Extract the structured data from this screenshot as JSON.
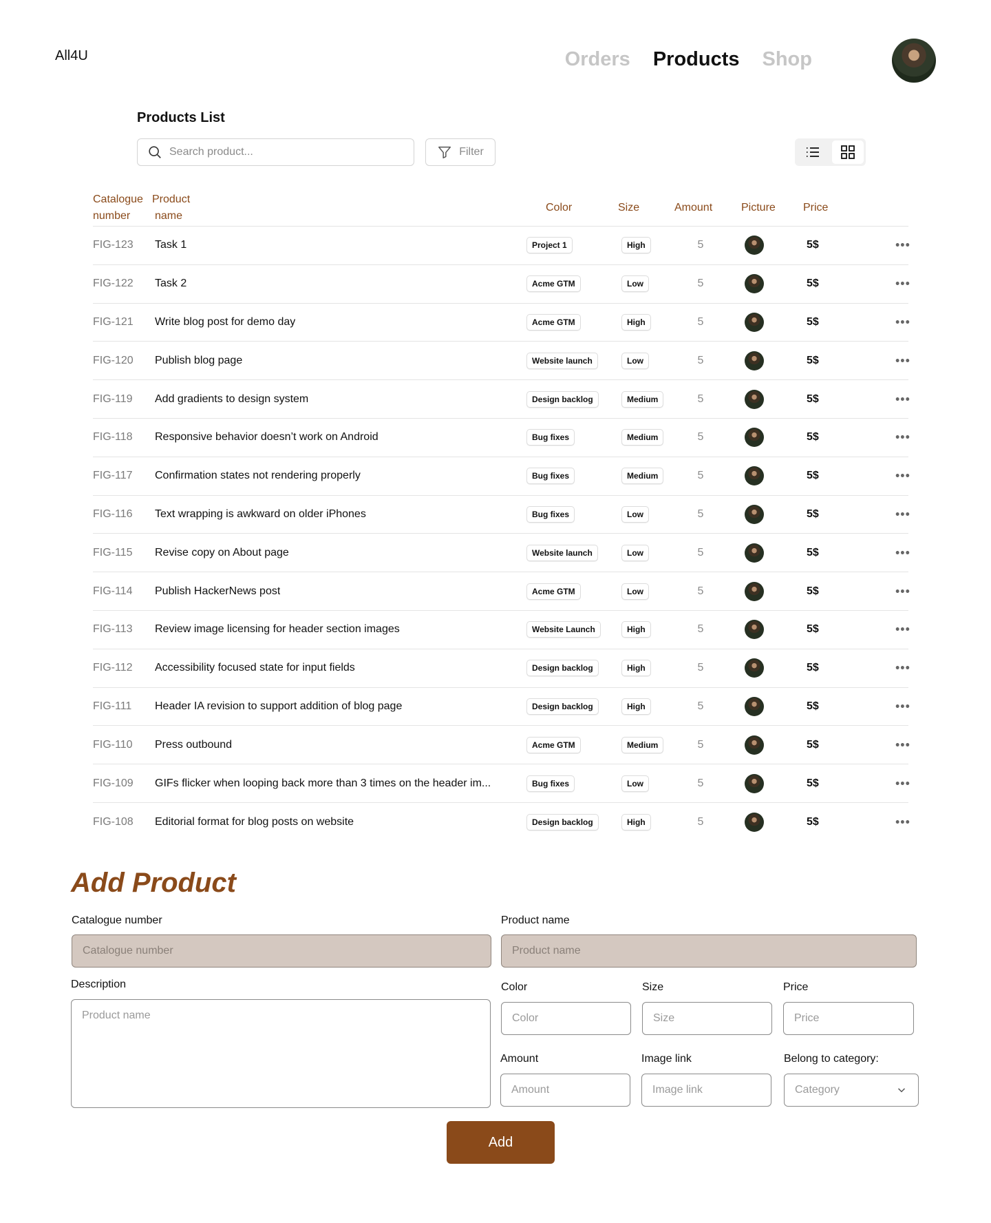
{
  "app": {
    "name": "All4U"
  },
  "nav": {
    "items": [
      {
        "label": "Orders",
        "active": false
      },
      {
        "label": "Products",
        "active": true
      },
      {
        "label": "Shop",
        "active": false
      }
    ]
  },
  "products_list": {
    "title": "Products List",
    "search_placeholder": "Search product...",
    "filter_label": "Filter",
    "columns": {
      "catalogue_line1": "Catalogue",
      "catalogue_line2": "number",
      "name_line1": "Product",
      "name_line2": "name",
      "color": "Color",
      "size": "Size",
      "amount": "Amount",
      "picture": "Picture",
      "price": "Price"
    },
    "rows": [
      {
        "num": "FIG-123",
        "name": "Task 1",
        "color": "Project 1",
        "size": "High",
        "amount": "5",
        "price": "5$"
      },
      {
        "num": "FIG-122",
        "name": "Task 2",
        "color": "Acme GTM",
        "size": "Low",
        "amount": "5",
        "price": "5$"
      },
      {
        "num": "FIG-121",
        "name": "Write blog post for demo day",
        "color": "Acme GTM",
        "size": "High",
        "amount": "5",
        "price": "5$"
      },
      {
        "num": "FIG-120",
        "name": "Publish blog page",
        "color": "Website launch",
        "size": "Low",
        "amount": "5",
        "price": "5$"
      },
      {
        "num": "FIG-119",
        "name": "Add gradients to design system",
        "color": "Design backlog",
        "size": "Medium",
        "amount": "5",
        "price": "5$"
      },
      {
        "num": "FIG-118",
        "name": "Responsive behavior doesn’t work on Android",
        "color": "Bug fixes",
        "size": "Medium",
        "amount": "5",
        "price": "5$"
      },
      {
        "num": "FIG-117",
        "name": "Confirmation states not rendering properly",
        "color": "Bug fixes",
        "size": "Medium",
        "amount": "5",
        "price": "5$"
      },
      {
        "num": "FIG-116",
        "name": "Text wrapping is awkward on older iPhones",
        "color": "Bug fixes",
        "size": "Low",
        "amount": "5",
        "price": "5$"
      },
      {
        "num": "FIG-115",
        "name": "Revise copy on About page",
        "color": "Website launch",
        "size": "Low",
        "amount": "5",
        "price": "5$"
      },
      {
        "num": "FIG-114",
        "name": "Publish HackerNews post",
        "color": "Acme GTM",
        "size": "Low",
        "amount": "5",
        "price": "5$"
      },
      {
        "num": "FIG-113",
        "name": "Review image licensing for header section images",
        "color": "Website Launch",
        "size": "High",
        "amount": "5",
        "price": "5$"
      },
      {
        "num": "FIG-112",
        "name": "Accessibility focused state for input fields",
        "color": "Design backlog",
        "size": "High",
        "amount": "5",
        "price": "5$"
      },
      {
        "num": "FIG-111",
        "name": "Header IA revision to support addition of blog page",
        "color": "Design backlog",
        "size": "High",
        "amount": "5",
        "price": "5$"
      },
      {
        "num": "FIG-110",
        "name": "Press outbound",
        "color": "Acme GTM",
        "size": "Medium",
        "amount": "5",
        "price": "5$"
      },
      {
        "num": "FIG-109",
        "name": "GIFs flicker when looping back more than 3 times on the header im...",
        "color": "Bug fixes",
        "size": "Low",
        "amount": "5",
        "price": "5$"
      },
      {
        "num": "FIG-108",
        "name": "Editorial format for blog posts on website",
        "color": "Design backlog",
        "size": "High",
        "amount": "5",
        "price": "5$"
      }
    ]
  },
  "add_product": {
    "title": "Add Product",
    "catalogue": {
      "label": "Catalogue number",
      "placeholder": "Catalogue number"
    },
    "name": {
      "label": "Product name",
      "placeholder": "Product name"
    },
    "description": {
      "label": "Description",
      "placeholder": "Product name"
    },
    "color": {
      "label": "Color",
      "placeholder": "Color"
    },
    "size": {
      "label": "Size",
      "placeholder": "Size"
    },
    "price": {
      "label": "Price",
      "placeholder": "Price"
    },
    "amount": {
      "label": "Amount",
      "placeholder": "Amount"
    },
    "image": {
      "label": "Image link",
      "placeholder": "Image link"
    },
    "category": {
      "label": "Belong to category:",
      "placeholder": "Category"
    },
    "submit_label": "Add"
  },
  "colors": {
    "accent": "#8a4a1a",
    "tan_field": "#d4c8c0"
  }
}
